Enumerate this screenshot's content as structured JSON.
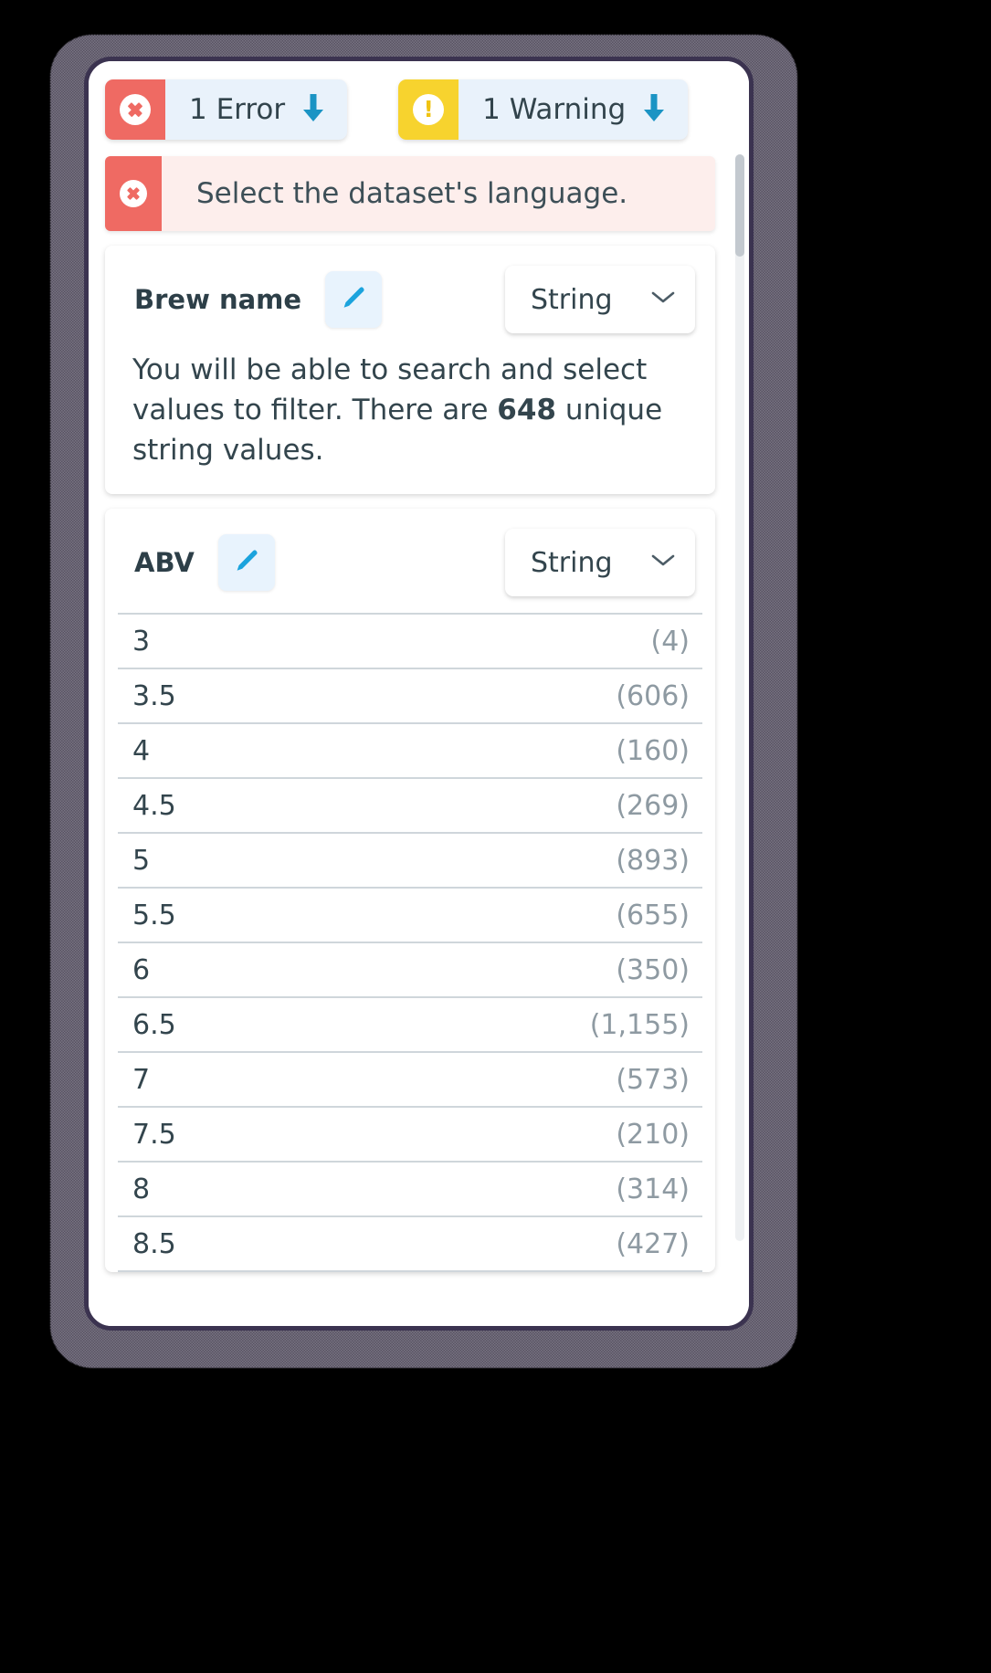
{
  "badges": [
    {
      "icon": "error-circle-icon",
      "label": "1 Error",
      "arrow": "arrow-down-icon",
      "accent": "#ef6a63"
    },
    {
      "icon": "warning-circle-icon",
      "label": "1 Warning",
      "arrow": "arrow-down-icon",
      "accent": "#f7d32e"
    }
  ],
  "alert": {
    "icon": "error-circle-icon",
    "message": "Select the dataset's language.",
    "accent": "#ef6a63",
    "background": "#fdeeec"
  },
  "fields": [
    {
      "name": "Brew name",
      "edit_icon": "pencil-icon",
      "type_label": "String",
      "type_chevron": "chevron-down-icon",
      "description_prefix": "You will be able to search and select values to filter. There are ",
      "description_count": "648",
      "description_suffix": " unique string values."
    },
    {
      "name": "ABV",
      "edit_icon": "pencil-icon",
      "type_label": "String",
      "type_chevron": "chevron-down-icon",
      "values": [
        {
          "value": "3",
          "count": "(4)"
        },
        {
          "value": "3.5",
          "count": "(606)"
        },
        {
          "value": "4",
          "count": "(160)"
        },
        {
          "value": "4.5",
          "count": "(269)"
        },
        {
          "value": "5",
          "count": "(893)"
        },
        {
          "value": "5.5",
          "count": "(655)"
        },
        {
          "value": "6",
          "count": "(350)"
        },
        {
          "value": "6.5",
          "count": "(1,155)"
        },
        {
          "value": "7",
          "count": "(573)"
        },
        {
          "value": "7.5",
          "count": "(210)"
        },
        {
          "value": "8",
          "count": "(314)"
        },
        {
          "value": "8.5",
          "count": "(427)"
        }
      ]
    }
  ],
  "colors": {
    "error": "#ef6a63",
    "warning": "#f7d32e",
    "accent_blue": "#1ba3dd",
    "badge_bg": "#e9f2fb",
    "text": "#33454d",
    "muted": "#8e9aa2"
  }
}
